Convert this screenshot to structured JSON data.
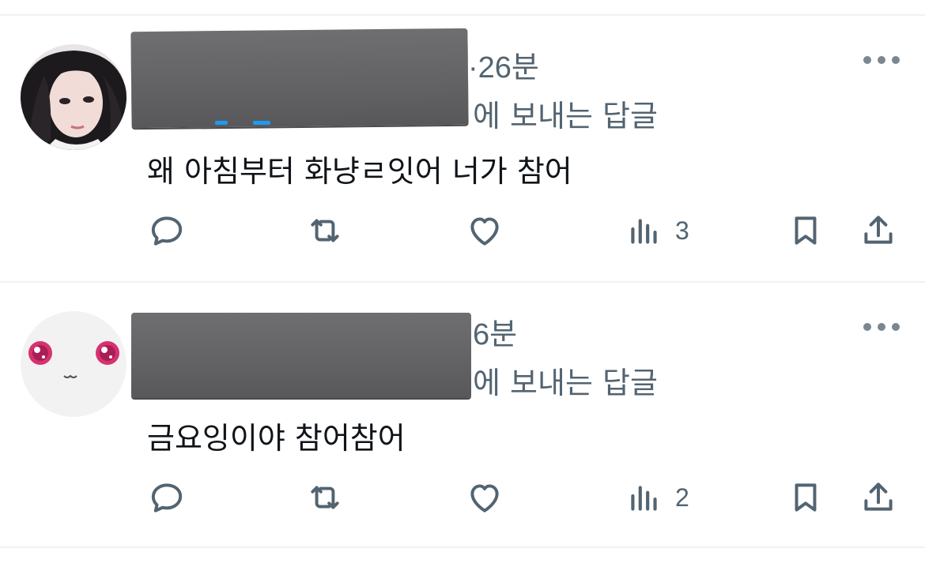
{
  "tweets": [
    {
      "time": "·26분",
      "reply_to_suffix": "에 보내는 답글",
      "text": "왜 아침부터 화냥ㄹ잇어 너가 참어",
      "views": "3"
    },
    {
      "time": "6분",
      "reply_to_suffix": "에 보내는 답글",
      "text": "금요잉이야 참어참어",
      "views": "2"
    }
  ],
  "icons": {
    "reply": "reply-icon",
    "retweet": "retweet-icon",
    "like": "heart-icon",
    "views": "views-icon",
    "bookmark": "bookmark-icon",
    "share": "share-icon",
    "more": "more-icon"
  },
  "colors": {
    "icon": "#536471",
    "text": "#0f1419",
    "link": "#1d9bf0",
    "divider": "#eff3f4"
  }
}
